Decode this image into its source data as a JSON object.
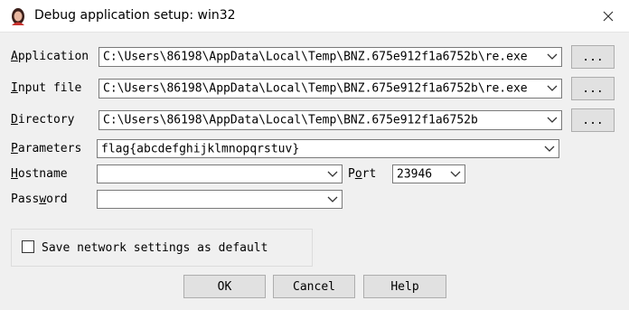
{
  "window": {
    "title": "Debug application setup: win32"
  },
  "fields": {
    "application": {
      "label_hot": "A",
      "label_rest": "pplication",
      "value": "C:\\Users\\86198\\AppData\\Local\\Temp\\BNZ.675e912f1a6752b\\re.exe"
    },
    "input_file": {
      "label_hot": "I",
      "label_rest": "nput file",
      "value": "C:\\Users\\86198\\AppData\\Local\\Temp\\BNZ.675e912f1a6752b\\re.exe"
    },
    "directory": {
      "label_hot": "D",
      "label_rest": "irectory",
      "value": "C:\\Users\\86198\\AppData\\Local\\Temp\\BNZ.675e912f1a6752b"
    },
    "parameters": {
      "label_hot": "P",
      "label_rest": "arameters",
      "value": "flag{abcdefghijklmnopqrstuv}"
    },
    "hostname": {
      "label_hot": "H",
      "label_rest": "ostname",
      "value": ""
    },
    "port": {
      "label_pre": "P",
      "label_hot": "o",
      "label_rest": "rt",
      "value": "23946"
    },
    "password": {
      "label_pre": "Pass",
      "label_hot": "w",
      "label_rest": "ord",
      "value": ""
    }
  },
  "browse_label": "...",
  "checkbox": {
    "label": "Save network settings as default",
    "checked": false
  },
  "buttons": {
    "ok": "OK",
    "cancel": "Cancel",
    "help": "Help"
  },
  "icons": {
    "app": "app-avatar-icon",
    "close": "close-icon",
    "dropdown": "chevron-down-icon"
  }
}
